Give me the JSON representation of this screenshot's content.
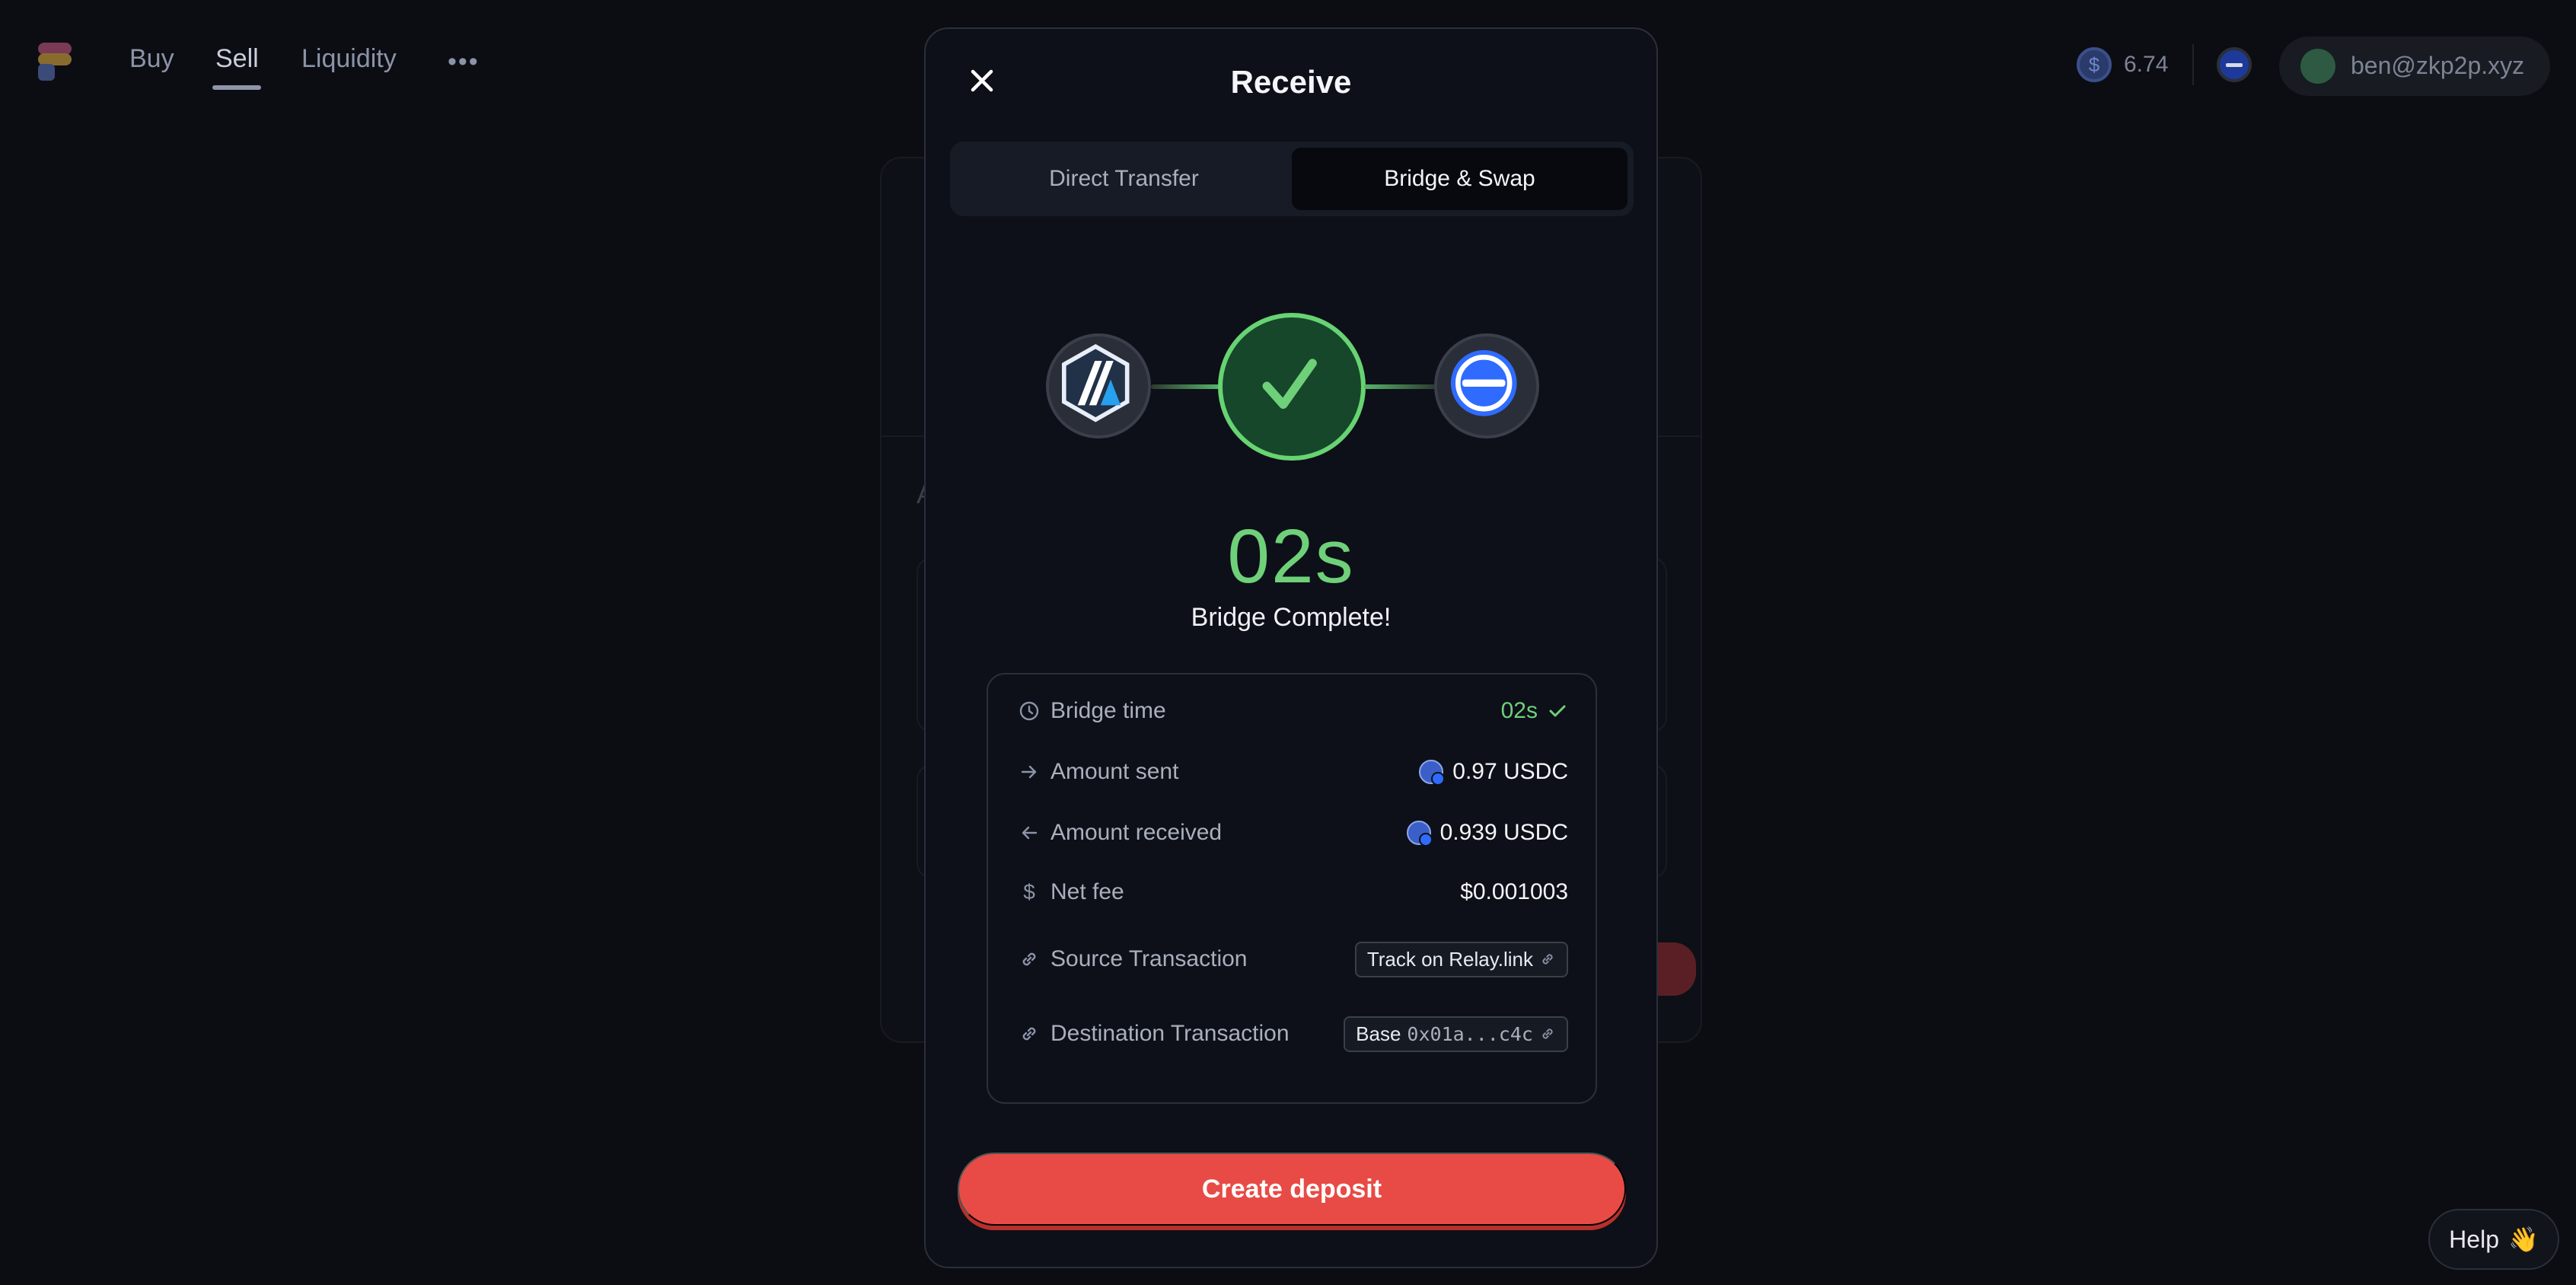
{
  "nav": {
    "items": [
      {
        "label": "Buy"
      },
      {
        "label": "Sell"
      },
      {
        "label": "Liquidity"
      }
    ],
    "more_label": "•••",
    "balance": "6.74",
    "user": "ben@zkp2p.xyz"
  },
  "modal": {
    "title": "Receive",
    "tabs": [
      {
        "label": "Direct Transfer",
        "active": false
      },
      {
        "label": "Bridge & Swap",
        "active": true
      }
    ],
    "flow": {
      "source_chain_icon": "arbitrum-icon",
      "status_icon": "check-icon",
      "destination_chain_icon": "base-icon"
    },
    "timer": "02s",
    "status_text": "Bridge Complete!",
    "details": {
      "bridge_time": {
        "label": "Bridge time",
        "value": "02s"
      },
      "amount_sent": {
        "label": "Amount sent",
        "value": "0.97 USDC"
      },
      "amount_received": {
        "label": "Amount received",
        "value": "0.939 USDC"
      },
      "net_fee": {
        "label": "Net fee",
        "value": "$0.001003"
      },
      "source_tx": {
        "label": "Source Transaction",
        "link_text": "Track on Relay.link"
      },
      "destination_tx": {
        "label": "Destination Transaction",
        "chain": "Base",
        "hash": "0x01a...c4c"
      }
    },
    "cta_label": "Create deposit"
  },
  "help": {
    "label": "Help",
    "emoji": "👋"
  },
  "colors": {
    "accent_red": "#e84b45",
    "success_green": "#6fd07a",
    "background": "#0b0d13"
  }
}
